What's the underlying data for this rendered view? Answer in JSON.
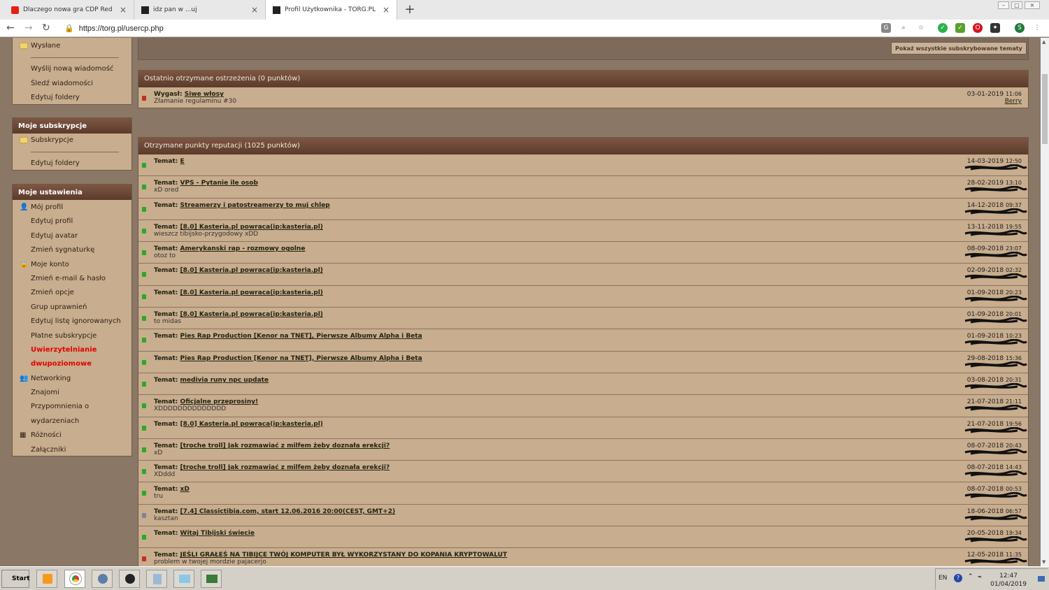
{
  "browser": {
    "tabs": [
      {
        "title": "Dlaczego nowa gra CDP Red nie jest"
      },
      {
        "title": "idz pan w ...uj"
      },
      {
        "title": "Profil Użytkownika - TORG.PL"
      }
    ],
    "url": "https://torg.pl/usercp.php",
    "profile_letter": "S"
  },
  "sidebar": {
    "messages_items": [
      "Wysłane",
      "Wyślij nową wiadomość",
      "Śledź wiadomości",
      "Edytuj foldery"
    ],
    "subs_header": "Moje subskrypcje",
    "subs_items": [
      "Subskrypcje",
      "Edytuj foldery"
    ],
    "settings_header": "Moje ustawienia",
    "settings_items": [
      {
        "label": "Mój profil",
        "icon": "user-icon"
      },
      {
        "label": "Edytuj profil"
      },
      {
        "label": "Edytuj avatar"
      },
      {
        "label": "Zmień sygnaturkę"
      },
      {
        "label": "Moje konto",
        "icon": "lock-icon"
      },
      {
        "label": "Zmień e-mail & hasło"
      },
      {
        "label": "Zmień opcje"
      },
      {
        "label": "Grup uprawnień"
      },
      {
        "label": "Edytuj listę ignorowanych"
      },
      {
        "label": "Płatne subskrypcje"
      },
      {
        "label": "Uwierzytelnianie",
        "red": true
      },
      {
        "label": "dwupoziomowe",
        "red": true
      },
      {
        "label": "Networking",
        "icon": "people-icon"
      },
      {
        "label": "Znajomi"
      },
      {
        "label": "Przypomnienia o"
      },
      {
        "label": "wydarzeniach"
      },
      {
        "label": "Różności",
        "icon": "misc-icon"
      },
      {
        "label": "Załączniki"
      }
    ]
  },
  "main": {
    "show_all_button": "Pokaż wszystkie subskrybowane tematy",
    "warnings": {
      "header": "Ostatnio otrzymane ostrzeżenia (0 punktów)",
      "prefix": "Wygasł:",
      "title": "Siwe włosy",
      "reason": "Złamanie regulaminu #30",
      "date": "03-01-2019",
      "time": "11:06",
      "author": "Berry"
    },
    "reputation": {
      "header": "Otrzymane punkty reputacji (1025 punktów)",
      "prefix": "Temat:",
      "rows": [
        {
          "title": "E",
          "sub": "",
          "date": "14-03-2019",
          "time": "12:50",
          "color": "#2aa82a"
        },
        {
          "title": "VPS - Pytanie ile osob",
          "sub": "xD ored",
          "date": "28-02-2019",
          "time": "13:10",
          "color": "#2aa82a"
        },
        {
          "title": "Streamerzy i patostreamerzy to muj chlep",
          "sub": "",
          "date": "14-12-2018",
          "time": "09:37",
          "color": "#2aa82a"
        },
        {
          "title": "[8.0] Kasteria.pl powraca(ip:kasteria.pl)",
          "sub": "wieszcz tibijsko-przygodowy xDD",
          "date": "13-11-2018",
          "time": "19:55",
          "color": "#2aa82a"
        },
        {
          "title": "Amerykanski rap - rozmowy ogolne",
          "sub": "otoz to",
          "date": "08-09-2018",
          "time": "23:07",
          "color": "#2aa82a"
        },
        {
          "title": "[8.0] Kasteria.pl powraca(ip:kasteria.pl)",
          "sub": "",
          "date": "02-09-2018",
          "time": "02:32",
          "color": "#2aa82a"
        },
        {
          "title": "[8.0] Kasteria.pl powraca(ip:kasteria.pl)",
          "sub": "",
          "date": "01-09-2018",
          "time": "20:23",
          "color": "#2aa82a"
        },
        {
          "title": "[8.0] Kasteria.pl powraca(ip:kasteria.pl)",
          "sub": "to midas",
          "date": "01-09-2018",
          "time": "20:01",
          "color": "#2aa82a"
        },
        {
          "title": "Pies Rap Production [Kenor na TNET], Pierwsze Albumy Alpha i Beta",
          "sub": "",
          "date": "01-09-2018",
          "time": "10:23",
          "color": "#2aa82a"
        },
        {
          "title": "Pies Rap Production [Kenor na TNET], Pierwsze Albumy Alpha i Beta",
          "sub": "",
          "date": "29-08-2018",
          "time": "15:36",
          "color": "#2aa82a"
        },
        {
          "title": "medivia runy npc update",
          "sub": "",
          "date": "03-08-2018",
          "time": "20:31",
          "color": "#2aa82a"
        },
        {
          "title": "Oficjalne przeprosiny!",
          "sub": "XDDDDDDDDDDDDDD",
          "date": "21-07-2018",
          "time": "21:11",
          "color": "#2aa82a"
        },
        {
          "title": "[8.0] Kasteria.pl powraca(ip:kasteria.pl)",
          "sub": "",
          "date": "21-07-2018",
          "time": "19:56",
          "color": "#2aa82a"
        },
        {
          "title": "[troche troll] Jak rozmawiać z milfem żeby doznała erekcji?",
          "sub": "xD",
          "date": "08-07-2018",
          "time": "20:43",
          "color": "#2aa82a"
        },
        {
          "title": "[troche troll] Jak rozmawiać z milfem żeby doznała erekcji?",
          "sub": "XDddd",
          "date": "08-07-2018",
          "time": "14:43",
          "color": "#2aa82a"
        },
        {
          "title": "xD",
          "sub": "tru",
          "date": "08-07-2018",
          "time": "00:53",
          "color": "#2aa82a"
        },
        {
          "title": "[7.4] Classictibia.com, start 12.06.2016 20:00(CEST, GMT+2)",
          "sub": "kasztan",
          "date": "18-06-2018",
          "time": "06:57",
          "color": "#8080a0"
        },
        {
          "title": "Witaj Tibijski świecie",
          "sub": "",
          "date": "20-05-2018",
          "time": "19:34",
          "color": "#2aa82a"
        },
        {
          "title": "JEŚLI GRAŁEŚ NA TIBIJCE TWÓJ KOMPUTER BYŁ WYKORZYSTANY DO KOPANIA KRYPTOWALUT",
          "sub": "problem w twojej mordzie pajacerjo",
          "date": "12-05-2018",
          "time": "11:35",
          "color": "#c03020"
        }
      ]
    }
  },
  "taskbar": {
    "start": "Start",
    "lang": "EN",
    "time": "12:47",
    "date": "01/04/2019"
  },
  "colors": {
    "panel_bg": "#c8ad8e",
    "header_bg": "#6b4a38",
    "page_bg": "#8b7766",
    "warning_red": "#e30000"
  }
}
